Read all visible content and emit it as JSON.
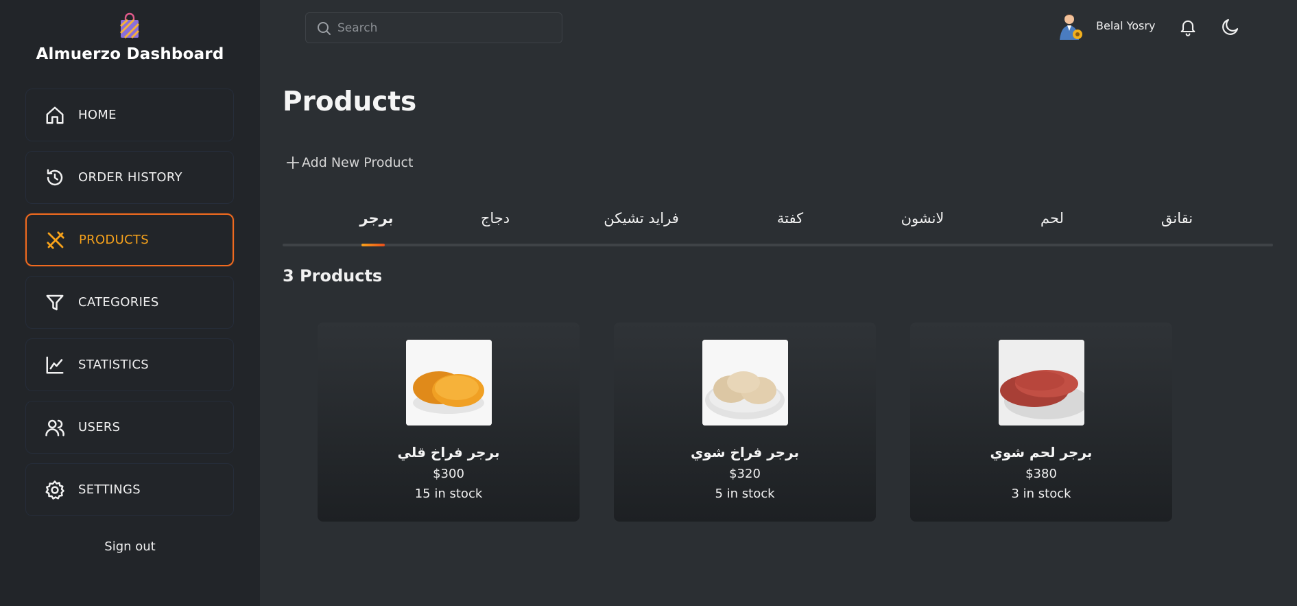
{
  "brand": {
    "title": "Almuerzo Dashboard",
    "logo_icon": "shopping-bag-icon"
  },
  "sidebar": {
    "items": [
      {
        "label": "HOME",
        "icon": "home-icon",
        "active": false
      },
      {
        "label": "ORDER HISTORY",
        "icon": "history-icon",
        "active": false
      },
      {
        "label": "PRODUCTS",
        "icon": "fork-knife-icon",
        "active": true
      },
      {
        "label": "CATEGORIES",
        "icon": "filter-icon",
        "active": false
      },
      {
        "label": "STATISTICS",
        "icon": "chart-line-icon",
        "active": false
      },
      {
        "label": "USERS",
        "icon": "users-icon",
        "active": false
      },
      {
        "label": "SETTINGS",
        "icon": "gear-icon",
        "active": false
      }
    ],
    "signout_label": "Sign out"
  },
  "header": {
    "search_placeholder": "Search",
    "user_name": "Belal Yosry"
  },
  "main": {
    "title": "Products",
    "add_label": "Add New Product",
    "tabs": [
      {
        "label": "برجر",
        "active": true
      },
      {
        "label": "دجاج",
        "active": false
      },
      {
        "label": "فرايد تشيكن",
        "active": false
      },
      {
        "label": "كفتة",
        "active": false
      },
      {
        "label": "لانشون",
        "active": false
      },
      {
        "label": "لحم",
        "active": false
      },
      {
        "label": "نقانق",
        "active": false
      }
    ],
    "product_count": "3 Products",
    "products": [
      {
        "name": "برجر فراخ قلي",
        "price": "$300",
        "stock": "15 in stock"
      },
      {
        "name": "برجر فراخ شوي",
        "price": "$320",
        "stock": "5 in stock"
      },
      {
        "name": "برجر لحم شوي",
        "price": "$380",
        "stock": "3 in stock"
      }
    ]
  },
  "colors": {
    "accent_orange": "#f7a21b",
    "accent_red": "#e94e1b",
    "sidebar_bg": "#222529",
    "main_bg": "#2b2f33"
  }
}
